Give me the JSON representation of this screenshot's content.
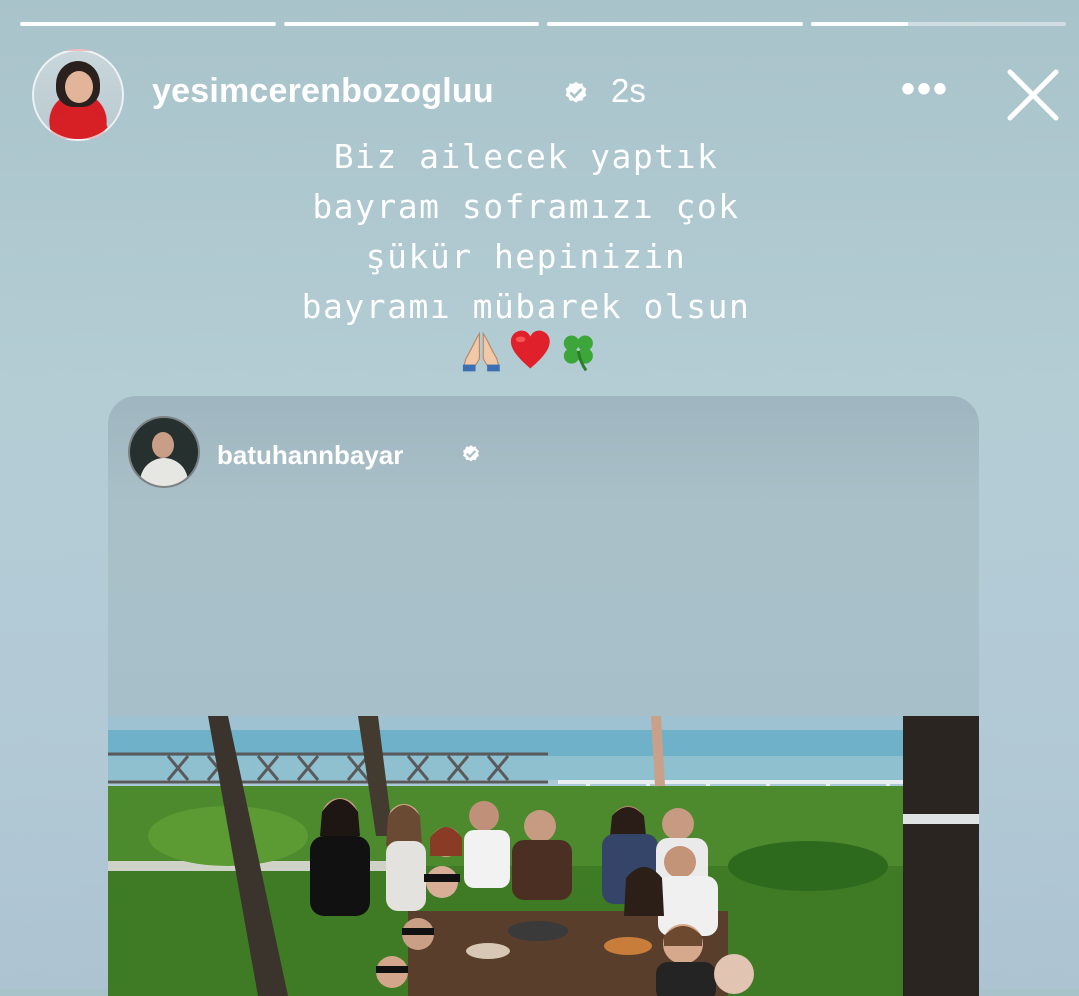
{
  "story": {
    "segments": [
      1.0,
      1.0,
      1.0,
      0.38
    ],
    "username": "yesimcerenbozogluu",
    "time": "2s",
    "more_label": "•••",
    "caption_lines": [
      "Biz ailecek yaptık",
      "bayram soframızı çok",
      "şükür hepinizin",
      "bayramı mübarek olsun"
    ],
    "emojis": [
      "🙏🏼",
      "❤️",
      "🍀"
    ]
  },
  "reshared_post": {
    "username": "batuhannbayar",
    "photo_icon": "group-photo"
  },
  "colors": {
    "background": "#b0c8d1",
    "text": "#ffffff",
    "accent_red": "#d71f26"
  }
}
